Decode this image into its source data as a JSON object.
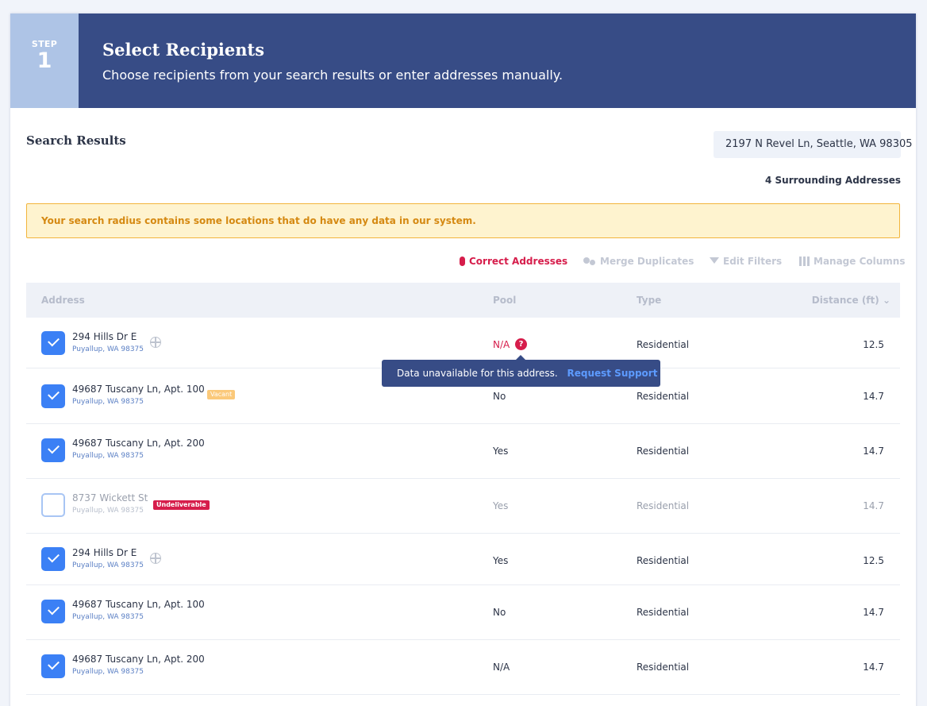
{
  "header": {
    "step_label": "STEP",
    "step_number": "1",
    "title": "Select Recipients",
    "subtitle": "Choose recipients from your search results or enter addresses manually."
  },
  "search": {
    "section_title": "Search Results",
    "address": "2197 N Revel Ln, Seattle, WA 98305",
    "surrounding_count": "4 Surrounding Addresses"
  },
  "alert": {
    "message": "Your search radius contains some locations that do have any data in our system.",
    "color": "#d58912"
  },
  "toolbar": {
    "correct": "Correct Addresses",
    "merge": "Merge Duplicates",
    "filters": "Edit Filters",
    "columns": "Manage Columns"
  },
  "table": {
    "headers": {
      "address": "Address",
      "pool": "Pool",
      "type": "Type",
      "distance": "Distance (ft)"
    },
    "rows": [
      {
        "line1": "294 Hills Dr E",
        "line2": "Puyallup, WA 98375",
        "pool": "N/A",
        "type": "Residential",
        "distance": "12.5",
        "checked": true
      },
      {
        "line1": "49687 Tuscany Ln, Apt. 100",
        "line2": "Puyallup, WA 98375",
        "pool": "No",
        "type": "Residential",
        "distance": "14.7",
        "checked": true,
        "badge": "Vacant"
      },
      {
        "line1": "49687 Tuscany Ln, Apt. 200",
        "line2": "Puyallup, WA 98375",
        "pool": "Yes",
        "type": "Residential",
        "distance": "14.7",
        "checked": true
      },
      {
        "line1": "8737 Wickett St",
        "line2": "Puyallup, WA 98375",
        "pool": "Yes",
        "type": "Residential",
        "distance": "14.7",
        "checked": false,
        "badge": "Undeliverable"
      },
      {
        "line1": "294 Hills Dr E",
        "line2": "Puyallup, WA 98375",
        "pool": "Yes",
        "type": "Residential",
        "distance": "12.5",
        "checked": true
      },
      {
        "line1": "49687 Tuscany Ln, Apt. 100",
        "line2": "Puyallup, WA 98375",
        "pool": "No",
        "type": "Residential",
        "distance": "14.7",
        "checked": true
      },
      {
        "line1": "49687 Tuscany Ln, Apt. 200",
        "line2": "Puyallup, WA 98375",
        "pool": "N/A",
        "type": "Residential",
        "distance": "14.7",
        "checked": true
      }
    ]
  },
  "tooltip": {
    "message": "Data unavailable for this address.",
    "link": "Request Support"
  },
  "colors": {
    "header_bg": "#374c86",
    "step_bg": "#aec4e6",
    "accent_blue": "#3b80f5",
    "alert_red": "#d61d4b",
    "vacant_badge": "#fbc97a"
  },
  "icons": {
    "row_location": "crosshair-icon",
    "pool_help": "question-icon",
    "sort": "chevron-down-icon",
    "checkbox": "checkmark-icon"
  }
}
